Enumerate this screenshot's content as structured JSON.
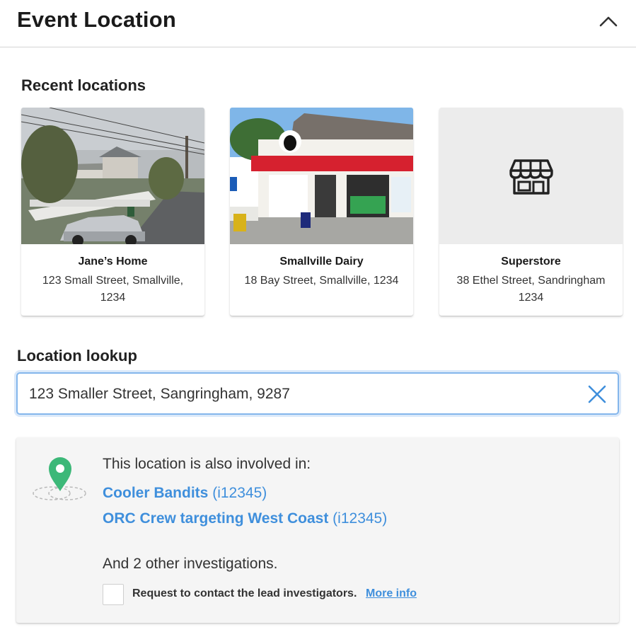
{
  "header": {
    "title": "Event Location",
    "collapse_icon": "chevron-up-icon"
  },
  "recent": {
    "title": "Recent locations",
    "items": [
      {
        "name": "Jane’s Home",
        "address": "123 Small Street, Smallville, 1234",
        "image": "street-photo"
      },
      {
        "name": "Smallville Dairy",
        "address": "18 Bay Street, Smallville, 1234",
        "image": "dairy-photo"
      },
      {
        "name": "Superstore",
        "address": "38 Ethel Street, Sandringham 1234",
        "image": "store-icon"
      }
    ]
  },
  "lookup": {
    "title": "Location lookup",
    "value": "123 Smaller Street, Sangringham, 9287",
    "clear_icon": "close-icon"
  },
  "involvement": {
    "label": "This location is also involved in:",
    "investigations": [
      {
        "name": "Cooler Bandits",
        "id": "(i12345)"
      },
      {
        "name": "ORC Crew targeting West Coast",
        "id": "(i12345)"
      }
    ],
    "other": "And 2 other investigations.",
    "request_label": "Request to contact the lead investigators.",
    "more_info": "More info",
    "pin_color": "#3cb878"
  },
  "colors": {
    "accent": "#3f8fdc",
    "focus_border": "#84b6ec"
  }
}
